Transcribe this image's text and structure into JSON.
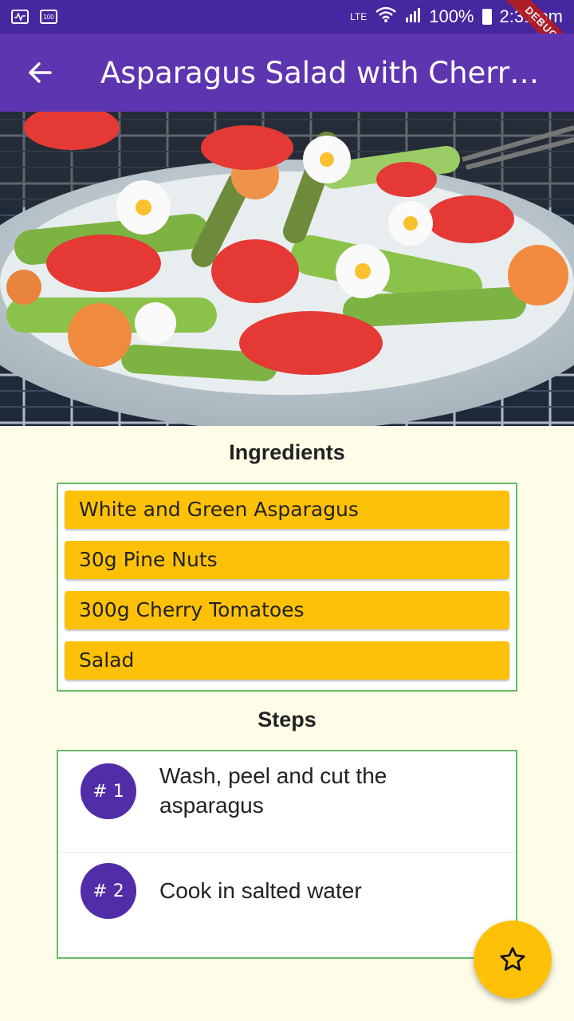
{
  "status_bar": {
    "battery": "100%",
    "time": "2:31 pm",
    "network": "LTE",
    "debug": "DEBUG",
    "left_icon_text": "100"
  },
  "app_bar": {
    "title": "Asparagus Salad with Cherry ..."
  },
  "ingredients": {
    "title": "Ingredients",
    "items": [
      "White and Green Asparagus",
      "30g Pine Nuts",
      "300g Cherry Tomatoes",
      "Salad"
    ]
  },
  "steps": {
    "title": "Steps",
    "items": [
      {
        "badge": "# 1",
        "text": "Wash, peel and cut the asparagus"
      },
      {
        "badge": "# 2",
        "text": "Cook in salted water"
      }
    ]
  },
  "colors": {
    "app_bar": "#5E35B1",
    "status_bar": "#4527A0",
    "ingredient_chip": "#FFC107",
    "step_badge": "#512DA8",
    "fab": "#FFC107",
    "border": "#66BB6A"
  },
  "icons": {
    "back": "arrow-left-icon",
    "fab": "star-outline-icon"
  }
}
